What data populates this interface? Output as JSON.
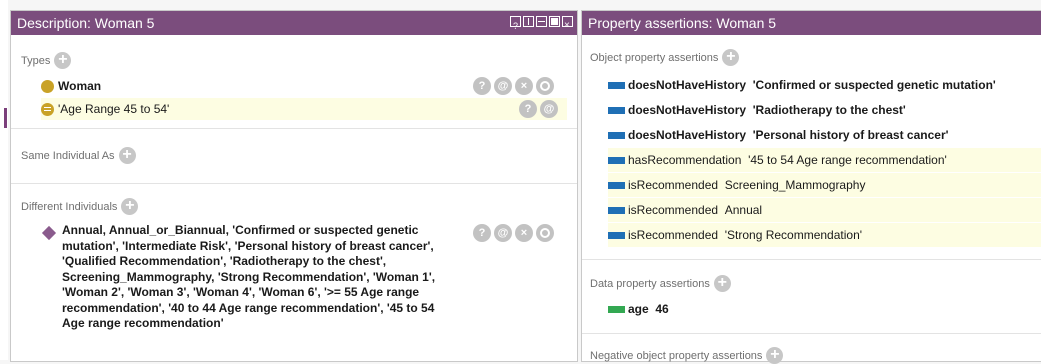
{
  "left_panel": {
    "title": "Description: Woman 5",
    "types": {
      "label": "Types",
      "items": [
        {
          "text": "Woman"
        },
        {
          "text": "'Age Range 45 to 54'"
        }
      ]
    },
    "same_individual": {
      "label": "Same Individual As"
    },
    "different_individuals": {
      "label": "Different Individuals",
      "text": "Annual, Annual_or_Biannual, 'Confirmed or suspected genetic mutation', 'Intermediate Risk', 'Personal history of breast cancer', 'Qualified Recommendation', 'Radiotherapy to the chest', Screening_Mammography, 'Strong Recommendation', 'Woman 1', 'Woman 2', 'Woman 3', 'Woman 4', 'Woman 6', '>= 55 Age range recommendation', '40 to 44 Age range recommendation', '45 to 54 Age range recommendation'"
    }
  },
  "right_panel": {
    "title": "Property assertions: Woman 5",
    "object_props": {
      "label": "Object property assertions",
      "items": [
        {
          "prop": "doesNotHaveHistory",
          "value": "'Confirmed or suspected genetic mutation'"
        },
        {
          "prop": "doesNotHaveHistory",
          "value": "'Radiotherapy to the chest'"
        },
        {
          "prop": "doesNotHaveHistory",
          "value": "'Personal history of breast cancer'"
        },
        {
          "prop": "hasRecommendation",
          "value": "'45 to 54 Age range recommendation'"
        },
        {
          "prop": "isRecommended",
          "value": "Screening_Mammography"
        },
        {
          "prop": "isRecommended",
          "value": "Annual"
        },
        {
          "prop": "isRecommended",
          "value": "'Strong Recommendation'"
        }
      ]
    },
    "data_props": {
      "label": "Data property assertions",
      "items": [
        {
          "prop": "age",
          "value": "46"
        }
      ]
    },
    "negative_object_props": {
      "label": "Negative object property assertions"
    }
  },
  "controls": {
    "help": "?",
    "annotate": "@",
    "delete": "×"
  },
  "colors": {
    "title_bar": "#7b4d7d",
    "highlight": "#fdfde2",
    "object_prop": "#1f6fb5",
    "data_prop": "#33a852",
    "individual": "#8a5b8d",
    "class": "#c9a227"
  }
}
